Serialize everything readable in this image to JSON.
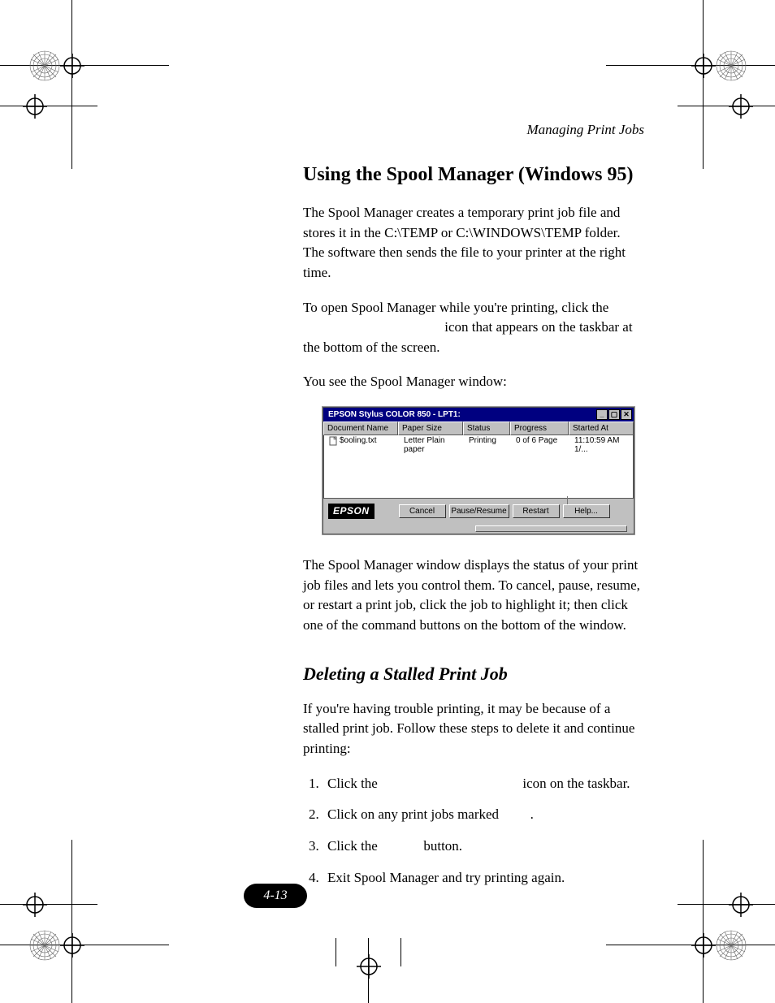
{
  "header": {
    "running": "Managing Print Jobs"
  },
  "section": {
    "title": "Using the Spool Manager (Windows 95)",
    "p1": "The Spool Manager creates a temporary print job file and stores it in the C:\\TEMP or C:\\WINDOWS\\TEMP folder. The software then sends the file to your printer at the right time.",
    "p2a": "To open Spool Manager while you're printing, click the",
    "p2b": "icon that appears on the taskbar at the bottom of the screen.",
    "p3": "You see the Spool Manager window:",
    "p4": "The Spool Manager window displays the status of your print job files and lets you control them. To cancel, pause, resume, or restart a print job, click the job to highlight it; then click one of the command buttons on the bottom of the window."
  },
  "spool": {
    "title": "EPSON Stylus COLOR 850 - LPT1:",
    "headers": {
      "doc": "Document Name",
      "paper": "Paper Size",
      "status": "Status",
      "progress": "Progress",
      "started": "Started At"
    },
    "row": {
      "doc": "$ooling.txt",
      "paper": "Letter Plain paper",
      "status": "Printing",
      "progress": "0 of 6 Page",
      "started": "11:10:59 AM 1/..."
    },
    "logo": "EPSON",
    "buttons": {
      "cancel": "Cancel",
      "pause": "Pause/Resume",
      "restart": "Restart",
      "help": "Help..."
    }
  },
  "sub": {
    "title": "Deleting a Stalled Print Job",
    "intro": "If you're having trouble printing, it may be because of a stalled print job. Follow these steps to delete it and continue printing:",
    "s1a": "Click the",
    "s1b": "icon on the taskbar.",
    "s2a": "Click on any print jobs marked",
    "s2b": ".",
    "s3a": "Click the",
    "s3b": "button.",
    "s4": "Exit Spool Manager and try printing again."
  },
  "page_number": "4-13"
}
